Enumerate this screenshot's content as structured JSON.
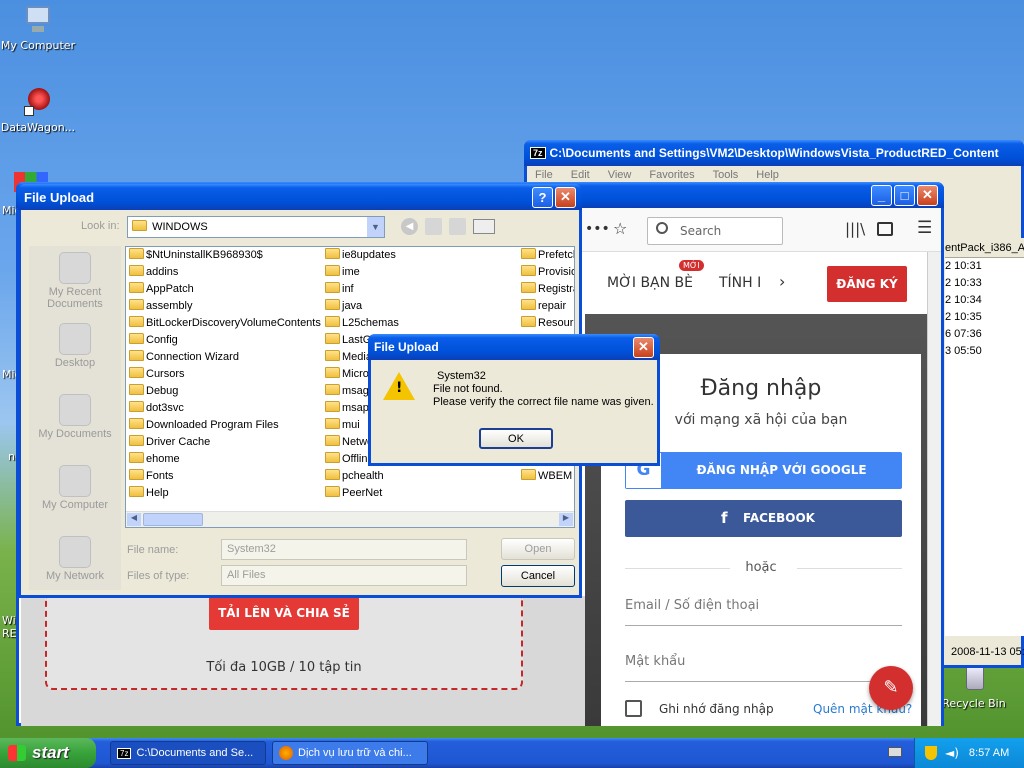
{
  "desktop": {
    "icons": [
      {
        "label": "My Computer",
        "name": "my-computer"
      },
      {
        "label": "DataWagon...",
        "name": "datawagon"
      },
      {
        "label": "Recycle Bin",
        "name": "recycle-bin"
      }
    ],
    "partial_labels": {
      "a": "Mic",
      "b": "Mic",
      "c": "ne",
      "d": "Wir",
      "e": "RE"
    }
  },
  "zip_window": {
    "title": "C:\\Documents and Settings\\VM2\\Desktop\\WindowsVista_ProductRED_Content",
    "menu": [
      "File",
      "Edit",
      "View",
      "Favorites",
      "Tools",
      "Help"
    ],
    "header_partial": "entPack_i386_AM",
    "times": [
      "2 10:31",
      "2 10:33",
      "2 10:34",
      "2 10:35",
      "6 07:36",
      "3 05:50"
    ],
    "bottom_date": "2008-11-13 05:"
  },
  "browser": {
    "search_placeholder": "Search",
    "nav": {
      "invite": "MỜI BẠN BÈ",
      "badge": "MỚI",
      "calc": "TÍNH I",
      "signup": "ĐĂNG KÝ"
    },
    "login": {
      "title": "Đăng nhập",
      "subtitle": "với mạng xã hội của bạn",
      "google": "ĐĂNG NHẬP VỚI GOOGLE",
      "facebook": "FACEBOOK",
      "or": "hoặc",
      "email_placeholder": "Email / Số điện thoại",
      "password_placeholder": "Mật khẩu",
      "remember": "Ghi nhớ đăng nhập",
      "forgot": "Quên mật khẩu?"
    },
    "upload": {
      "button": "TẢI LÊN VÀ CHIA SẺ",
      "limit": "Tối đa 10GB / 10 tập tin"
    }
  },
  "file_upload": {
    "title": "File Upload",
    "look_in_label": "Look in:",
    "look_in_value": "WINDOWS",
    "places": [
      "My Recent Documents",
      "Desktop",
      "My Documents",
      "My Computer",
      "My Network"
    ],
    "files_col1": [
      "$NtUninstallKB968930$",
      "addins",
      "AppPatch",
      "assembly",
      "BitLockerDiscoveryVolumeContents",
      "Config",
      "Connection Wizard",
      "Cursors",
      "Debug",
      "dot3svc",
      "Downloaded Program Files",
      "Driver Cache",
      "ehome",
      "Fonts",
      "Help"
    ],
    "files_col2": [
      "ie8updates",
      "ime",
      "inf",
      "java",
      "L25chemas",
      "LastG",
      "Media",
      "Micros",
      "msage",
      "msapp",
      "mui",
      "Netwo",
      "Offline",
      "pchealth",
      "PeerNet"
    ],
    "files_col3": [
      "Prefetch",
      "Provisio",
      "Registra",
      "repair",
      "Resourc",
      "",
      "",
      "",
      "",
      "",
      "",
      "",
      "twain_3",
      "WBEM"
    ],
    "file_name_label": "File name:",
    "file_name_value": "System32",
    "file_type_label": "Files of type:",
    "file_type_value": "All Files",
    "open": "Open",
    "cancel": "Cancel"
  },
  "error_dialog": {
    "title": "File Upload",
    "line1": "System32",
    "line2": "File not found.",
    "line3": "Please verify the correct file name was given.",
    "ok": "OK"
  },
  "taskbar": {
    "start": "start",
    "tasks": [
      "C:\\Documents and Se...",
      "Dịch vụ lưu trữ và chi..."
    ],
    "clock": "8:57 AM"
  }
}
